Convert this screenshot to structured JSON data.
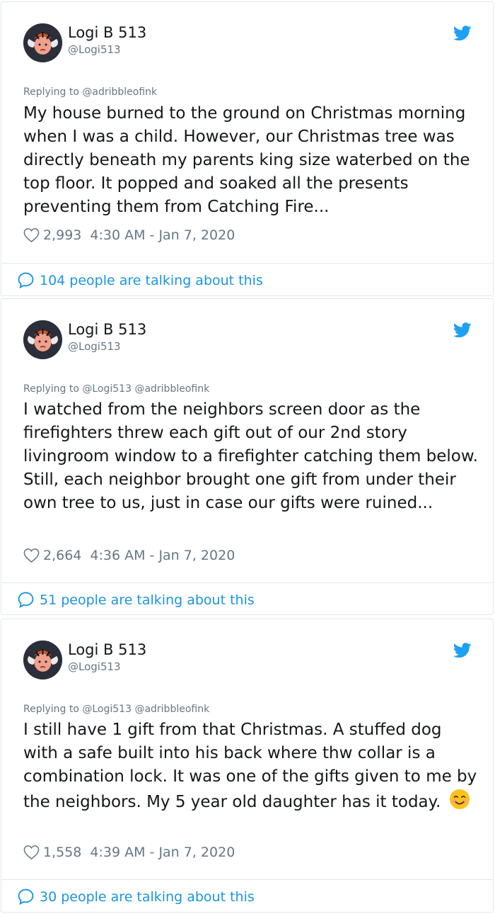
{
  "tweets": [
    {
      "display_name": "Logi B 513",
      "handle": "@Logi513",
      "replying_to": "Replying to @adribbleofink",
      "text": "My house burned to the ground on Christmas morning when I was a child. However, our Christmas tree was directly beneath my parents king size waterbed on the top floor. It popped and soaked all the presents preventing them from Catching Fire...",
      "likes": "2,993",
      "timestamp": "4:30 AM - Jan 7, 2020",
      "talking": "104 people are talking about this"
    },
    {
      "display_name": "Logi B 513",
      "handle": "@Logi513",
      "replying_to": "Replying to @Logi513 @adribbleofink",
      "text": "I watched from the neighbors screen door as the firefighters threw each gift out of our 2nd story livingroom window to a firefighter catching them below. Still, each neighbor brought one gift from under their own tree to us, just in case our gifts were ruined...",
      "likes": "2,664",
      "timestamp": "4:36 AM - Jan 7, 2020",
      "talking": "51 people are talking about this"
    },
    {
      "display_name": "Logi B 513",
      "handle": "@Logi513",
      "replying_to": "Replying to @Logi513 @adribbleofink",
      "text": "I still have 1 gift from that Christmas. A stuffed dog with a safe built into his back where thw collar is a combination lock. It was one of the gifts given to me by the neighbors. My 5 year old daughter has it today.",
      "emoji": "smiling-face-emoji",
      "likes": "1,558",
      "timestamp": "4:39 AM - Jan 7, 2020",
      "talking": "30 people are talking about this"
    }
  ],
  "icons": {
    "brand": "twitter-bird-icon",
    "like": "heart-icon",
    "reply": "speech-bubble-icon"
  },
  "colors": {
    "twitter_blue": "#1da1f2",
    "link_blue": "#1b95e0",
    "secondary_text": "#657786",
    "border": "#e1e8ed"
  }
}
